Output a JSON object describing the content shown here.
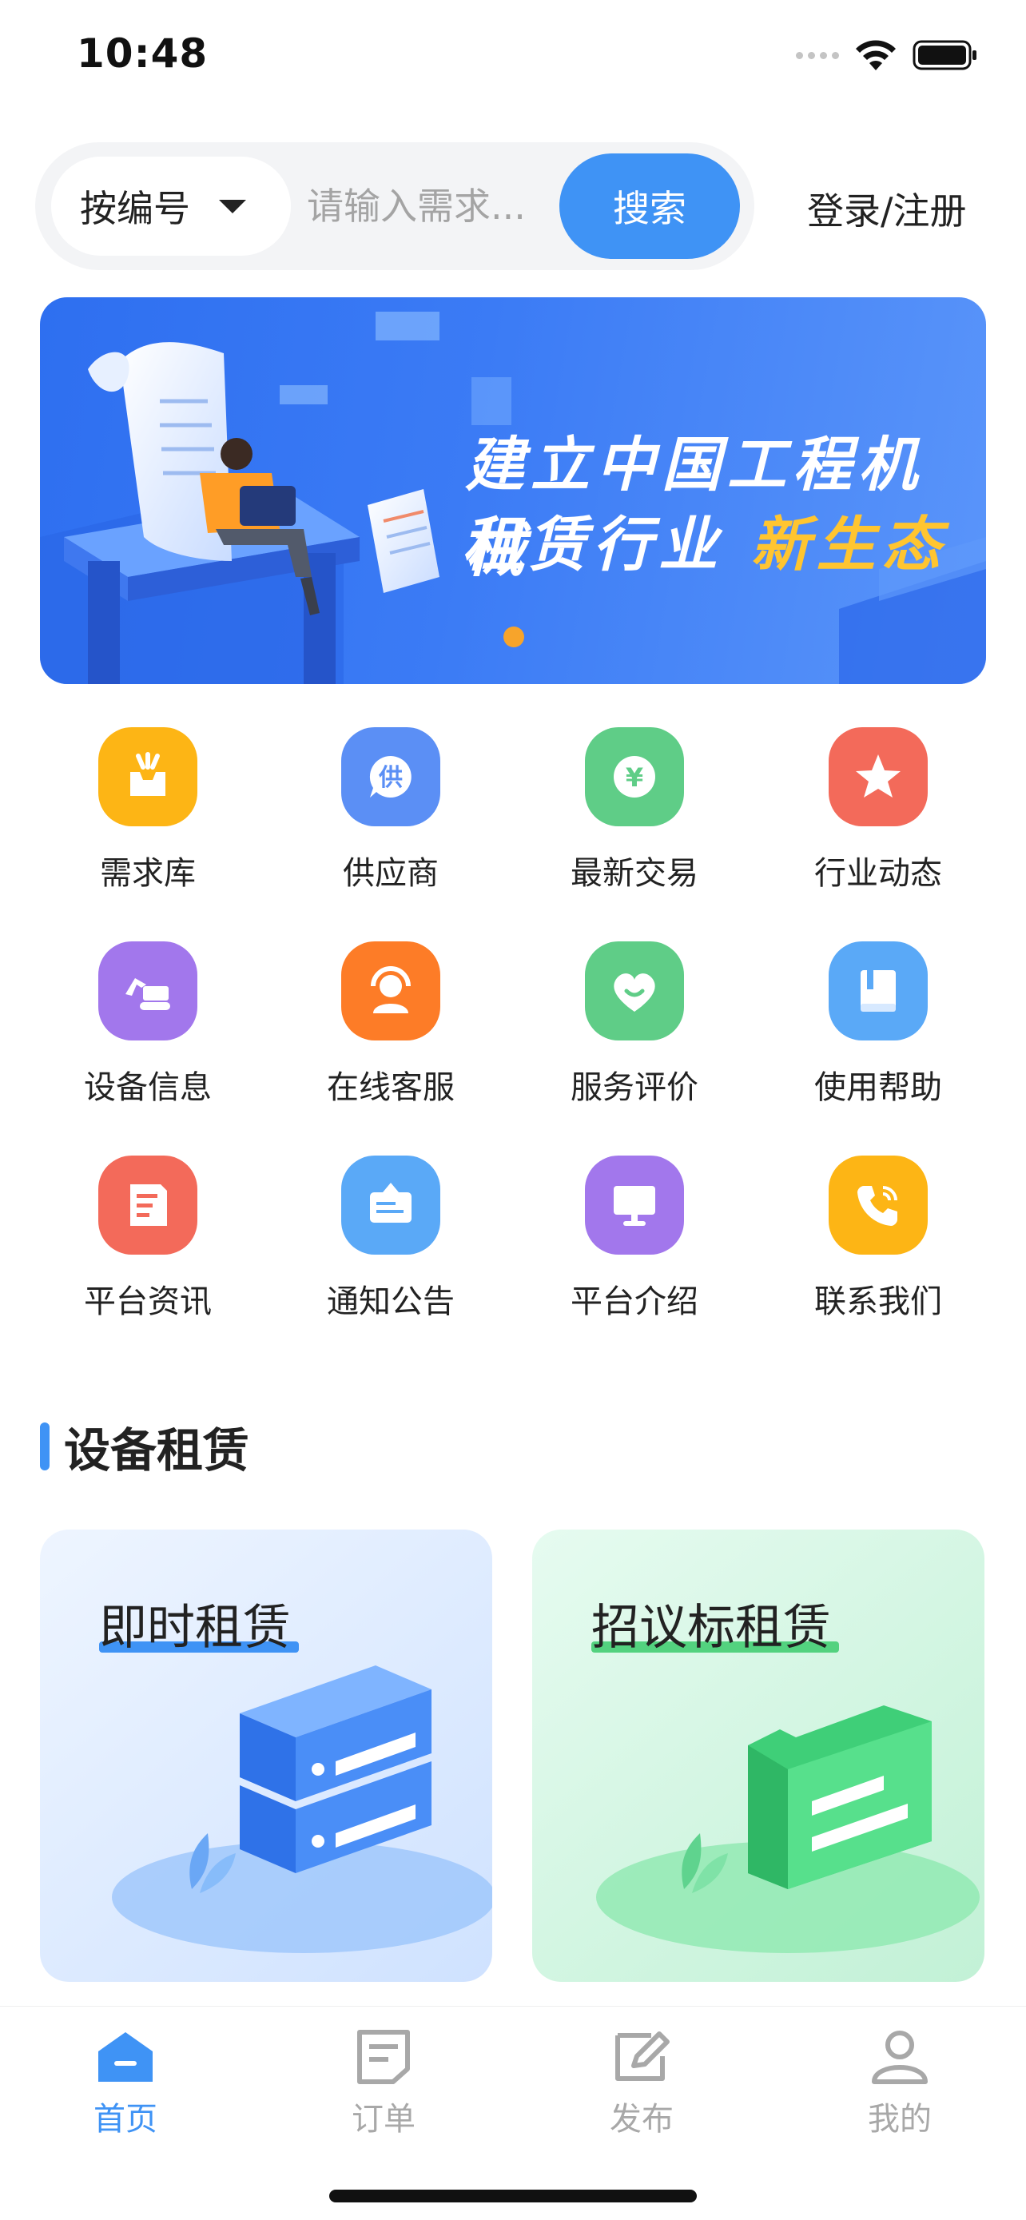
{
  "status_bar": {
    "time": "10:48"
  },
  "search": {
    "category_label": "按编号",
    "placeholder": "请输入需求...",
    "button_label": "搜索",
    "login_label": "登录/注册"
  },
  "banner": {
    "line1": "建立中国工程机械",
    "line2_prefix": "租赁行业",
    "line2_highlight": "新生态"
  },
  "grid": [
    {
      "label": "需求库",
      "icon": "inbox-icon",
      "color": "#fdb515"
    },
    {
      "label": "供应商",
      "icon": "supplier-icon",
      "color": "#5b8ff5"
    },
    {
      "label": "最新交易",
      "icon": "yuan-icon",
      "color": "#5fcd87"
    },
    {
      "label": "行业动态",
      "icon": "star-icon",
      "color": "#f36a5a"
    },
    {
      "label": "设备信息",
      "icon": "excavator-icon",
      "color": "#a277ec"
    },
    {
      "label": "在线客服",
      "icon": "headset-icon",
      "color": "#fd7c27"
    },
    {
      "label": "服务评价",
      "icon": "heart-icon",
      "color": "#5fcd87"
    },
    {
      "label": "使用帮助",
      "icon": "book-icon",
      "color": "#5aa9f7"
    },
    {
      "label": "平台资讯",
      "icon": "news-icon",
      "color": "#f36a5a"
    },
    {
      "label": "通知公告",
      "icon": "notice-icon",
      "color": "#5aa9f7"
    },
    {
      "label": "平台介绍",
      "icon": "monitor-icon",
      "color": "#a277ec"
    },
    {
      "label": "联系我们",
      "icon": "phone-icon",
      "color": "#fdb515"
    }
  ],
  "section": {
    "title": "设备租赁"
  },
  "cards": [
    {
      "title": "即时租赁",
      "accent": "#3f93f5"
    },
    {
      "title": "招议标租赁",
      "accent": "#53d27f"
    }
  ],
  "tabs": [
    {
      "label": "首页",
      "icon": "home-icon",
      "active": true
    },
    {
      "label": "订单",
      "icon": "order-icon",
      "active": false
    },
    {
      "label": "发布",
      "icon": "publish-icon",
      "active": false
    },
    {
      "label": "我的",
      "icon": "profile-icon",
      "active": false
    }
  ],
  "colors": {
    "primary": "#3f93f5",
    "inactive": "#a8a8a8"
  }
}
